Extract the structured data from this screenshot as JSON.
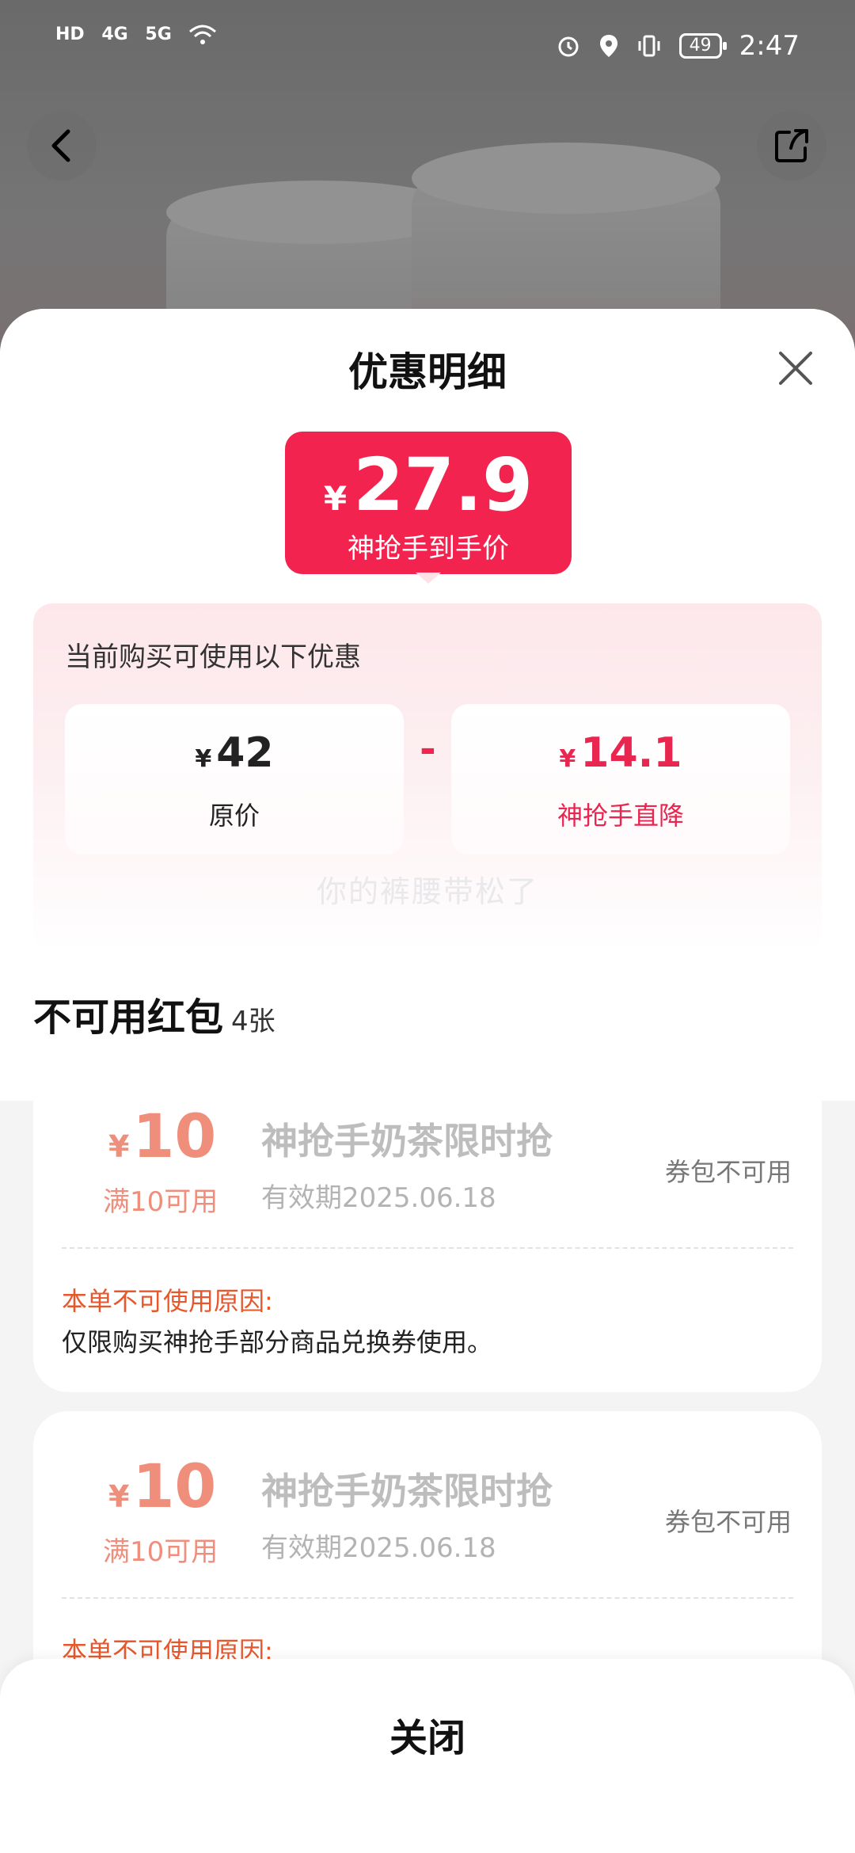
{
  "status_bar": {
    "left_labels": [
      "HD",
      "4G",
      "5G"
    ],
    "time": "2:47",
    "battery": "49"
  },
  "sheet": {
    "title": "优惠明细",
    "final_price": {
      "currency": "¥",
      "value": "27.9",
      "label": "神抢手到手价"
    },
    "calc": {
      "title": "当前购买可使用以下优惠",
      "original": {
        "currency": "¥",
        "value": "42",
        "label": "原价"
      },
      "operator": "-",
      "discount": {
        "currency": "¥",
        "value": "14.1",
        "label": "神抢手直降"
      }
    },
    "watermark": "你的裤腰带松了",
    "unavailable": {
      "heading": "不可用红包",
      "count": "4张",
      "coupons": [
        {
          "currency": "¥",
          "value": "10",
          "condition": "满10可用",
          "name": "神抢手奶茶限时抢",
          "expiry": "有效期2025.06.18",
          "status": "券包不可用",
          "reason_title": "本单不可使用原因:",
          "reason": "仅限购买神抢手部分商品兑换券使用。"
        },
        {
          "currency": "¥",
          "value": "10",
          "condition": "满10可用",
          "name": "神抢手奶茶限时抢",
          "expiry": "有效期2025.06.18",
          "status": "券包不可用",
          "reason_title": "本单不可使用原因:"
        }
      ]
    },
    "close_label": "关闭"
  },
  "colors": {
    "accent": "#f3234f",
    "coupon_value": "#f08e7c",
    "reason_title": "#e8572c"
  }
}
